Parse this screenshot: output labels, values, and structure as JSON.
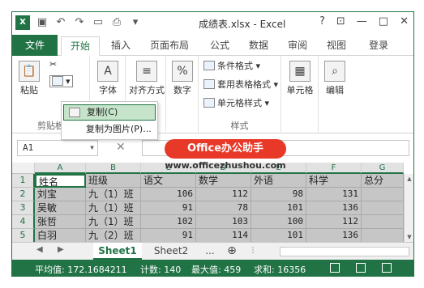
{
  "window": {
    "title": "成绩表.xlsx - Excel",
    "logo": "X"
  },
  "qat": {
    "icons": [
      "save-icon",
      "undo-icon",
      "redo-icon",
      "open-icon",
      "print-icon",
      "customize-icon"
    ]
  },
  "controls": {
    "help": "?",
    "restore": "⊡",
    "minimize": "—",
    "maximize": "□",
    "close": "✕"
  },
  "tabs": [
    "文件",
    "开始",
    "插入",
    "页面布局",
    "公式",
    "数据",
    "审阅",
    "视图",
    "登录"
  ],
  "ribbon": {
    "paste_label": "粘贴",
    "clipboard_label": "剪贴板",
    "font_label": "字体",
    "align_label": "对齐方式",
    "number_label": "数字",
    "cond_format": "条件格式",
    "table_format": "套用表格格式",
    "cell_style": "单元格样式",
    "style_group": "样式",
    "cells_label": "单元格",
    "edit_label": "编辑"
  },
  "menu": {
    "copy": "复制(C)",
    "copy_picture": "复制为图片(P)..."
  },
  "watermark": {
    "badge": "Office办公助手",
    "url": "www.officezhushou.com"
  },
  "formula_bar": {
    "name_box": "A1",
    "cancel": "✕"
  },
  "grid": {
    "columns": [
      "A",
      "B",
      "C",
      "D",
      "E",
      "F",
      "G"
    ],
    "rows": [
      {
        "num": "1",
        "cells": [
          "姓名",
          "班级",
          "语文",
          "数学",
          "外语",
          "科学",
          "总分"
        ]
      },
      {
        "num": "2",
        "cells": [
          "刘宝",
          "九（1）班",
          "106",
          "112",
          "98",
          "131",
          ""
        ]
      },
      {
        "num": "3",
        "cells": [
          "吴敏",
          "九（1）班",
          "91",
          "78",
          "101",
          "136",
          ""
        ]
      },
      {
        "num": "4",
        "cells": [
          "张哲",
          "九（1）班",
          "102",
          "103",
          "100",
          "112",
          ""
        ]
      },
      {
        "num": "5",
        "cells": [
          "白羽",
          "九（2）班",
          "91",
          "114",
          "101",
          "136",
          ""
        ]
      }
    ]
  },
  "sheets": [
    "Sheet1",
    "Sheet2",
    "..."
  ],
  "status": {
    "average": "平均值: 172.1684211",
    "count": "计数: 140",
    "max": "最大值: 459",
    "sum": "求和: 16356"
  },
  "colors": {
    "accent": "#217346",
    "selection": "#c6c6c6",
    "watermark": "#e83828"
  }
}
